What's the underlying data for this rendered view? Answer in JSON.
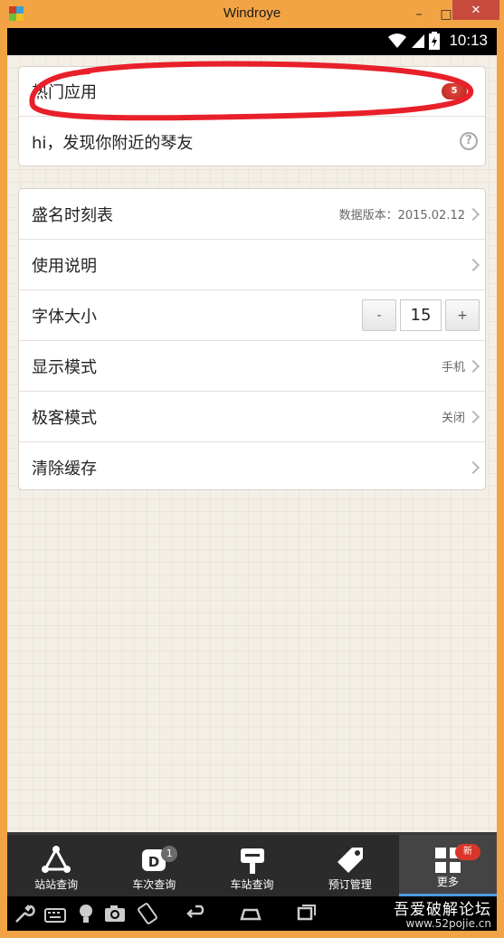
{
  "window": {
    "title": "Windroye",
    "min_label": "–",
    "max_label": "□",
    "close_label": "✕"
  },
  "status_bar": {
    "time": "10:13"
  },
  "card1": {
    "rows": [
      {
        "label": "热门应用",
        "badge": "5"
      },
      {
        "label": "hi，发现你附近的琴友",
        "help": "?"
      }
    ]
  },
  "card2": {
    "rows": [
      {
        "label": "盛名时刻表",
        "value": "数据版本：2015.02.12"
      },
      {
        "label": "使用说明",
        "value": ""
      },
      {
        "label": "字体大小",
        "stepper": {
          "minus": "-",
          "value": "15",
          "plus": "+"
        }
      },
      {
        "label": "显示模式",
        "value": "手机"
      },
      {
        "label": "极客模式",
        "value": "关闭"
      },
      {
        "label": "清除缓存",
        "value": ""
      }
    ]
  },
  "tabs": [
    {
      "label": "站站查询",
      "icon": "triangle-route-icon"
    },
    {
      "label": "车次查询",
      "icon": "train-d-icon",
      "count": "1"
    },
    {
      "label": "车站查询",
      "icon": "station-sign-icon"
    },
    {
      "label": "预订管理",
      "icon": "tag-icon"
    },
    {
      "label": "更多",
      "icon": "grid-icon",
      "badge": "新",
      "active": true
    }
  ],
  "nav_bar": {
    "icons": [
      "wrench-icon",
      "keyboard-icon",
      "bulb-icon",
      "camera-icon",
      "rotate-icon",
      "back-icon",
      "home-icon",
      "recent-apps-icon"
    ],
    "watermark": {
      "cn": "吾爱破解论坛",
      "url": "www.52pojie.cn"
    }
  },
  "colors": {
    "frame": "#f2a444",
    "close": "#c74b3d",
    "annotation": "#e8202a",
    "badge": "#d9362b",
    "tab_active_underline": "#4a9de0"
  }
}
